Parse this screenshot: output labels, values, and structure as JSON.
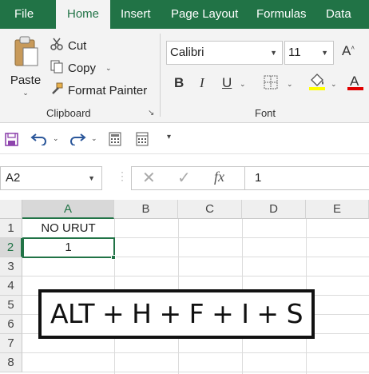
{
  "ribbon": {
    "tabs": [
      {
        "label": "File",
        "active": false
      },
      {
        "label": "Home",
        "active": true
      },
      {
        "label": "Insert",
        "active": false
      },
      {
        "label": "Page Layout",
        "active": false
      },
      {
        "label": "Formulas",
        "active": false
      },
      {
        "label": "Data",
        "active": false
      }
    ],
    "clipboard": {
      "paste_label": "Paste",
      "cut_label": "Cut",
      "copy_label": "Copy",
      "format_painter_label": "Format Painter",
      "group_label": "Clipboard"
    },
    "font": {
      "font_name": "Calibri",
      "font_size": "11",
      "bold": "B",
      "italic": "I",
      "underline": "U",
      "group_label": "Font"
    }
  },
  "formula_bar": {
    "name_box": "A2",
    "fx_label": "fx",
    "content": "1"
  },
  "grid": {
    "columns": [
      "A",
      "B",
      "C",
      "D",
      "E"
    ],
    "rows": [
      "1",
      "2",
      "3",
      "4",
      "5",
      "6",
      "7",
      "8"
    ],
    "cells": {
      "A1": "NO URUT",
      "A2": "1"
    },
    "selected_cell": "A2"
  },
  "overlay": {
    "shortcut_text": "ALT + H + F + I + S"
  },
  "colors": {
    "brand": "#217346",
    "highlight": "#FFFF00",
    "font_color": "#E00000"
  }
}
